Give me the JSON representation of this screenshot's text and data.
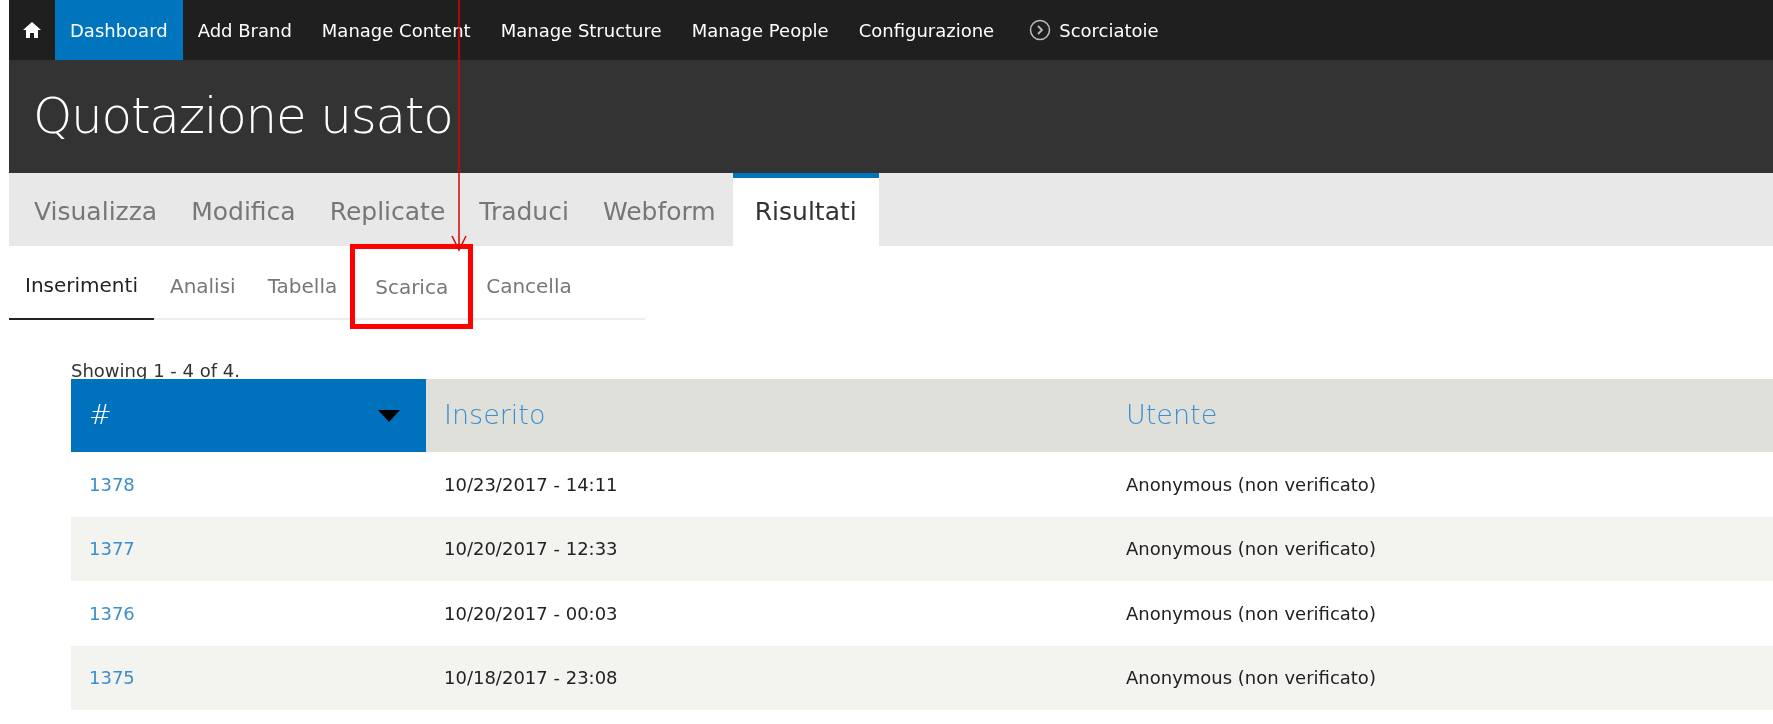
{
  "toolbar": {
    "items": [
      {
        "label": "Dashboard",
        "selected": true
      },
      {
        "label": "Add Brand",
        "selected": false
      },
      {
        "label": "Manage Content",
        "selected": false
      },
      {
        "label": "Manage Structure",
        "selected": false
      },
      {
        "label": "Manage People",
        "selected": false
      },
      {
        "label": "Configurazione",
        "selected": false
      }
    ],
    "shortcuts": "Scorciatoie"
  },
  "page_title": "Quotazione usato",
  "tabs": [
    {
      "label": "Visualizza",
      "selected": false
    },
    {
      "label": "Modifica",
      "selected": false
    },
    {
      "label": "Replicate",
      "selected": false
    },
    {
      "label": "Traduci",
      "selected": false
    },
    {
      "label": "Webform",
      "selected": false
    },
    {
      "label": "Risultati",
      "selected": true
    }
  ],
  "subtabs": [
    {
      "label": "Inserimenti",
      "selected": true,
      "highlighted": false
    },
    {
      "label": "Analisi",
      "selected": false,
      "highlighted": false
    },
    {
      "label": "Tabella",
      "selected": false,
      "highlighted": false
    },
    {
      "label": "Scarica",
      "selected": false,
      "highlighted": true
    },
    {
      "label": "Cancella",
      "selected": false,
      "highlighted": false
    }
  ],
  "summary": "Showing 1 - 4 of 4.",
  "table": {
    "columns": [
      {
        "label": "#",
        "sorted": true
      },
      {
        "label": "Inserito",
        "sorted": false
      },
      {
        "label": "Utente",
        "sorted": false
      }
    ],
    "rows": [
      [
        "1378",
        "10/23/2017 - 14:11",
        "Anonymous (non verificato)"
      ],
      [
        "1377",
        "10/20/2017 - 12:33",
        "Anonymous (non verificato)"
      ],
      [
        "1376",
        "10/20/2017 - 00:03",
        "Anonymous (non verificato)"
      ],
      [
        "1375",
        "10/18/2017 - 23:08",
        "Anonymous (non verificato)"
      ]
    ]
  }
}
